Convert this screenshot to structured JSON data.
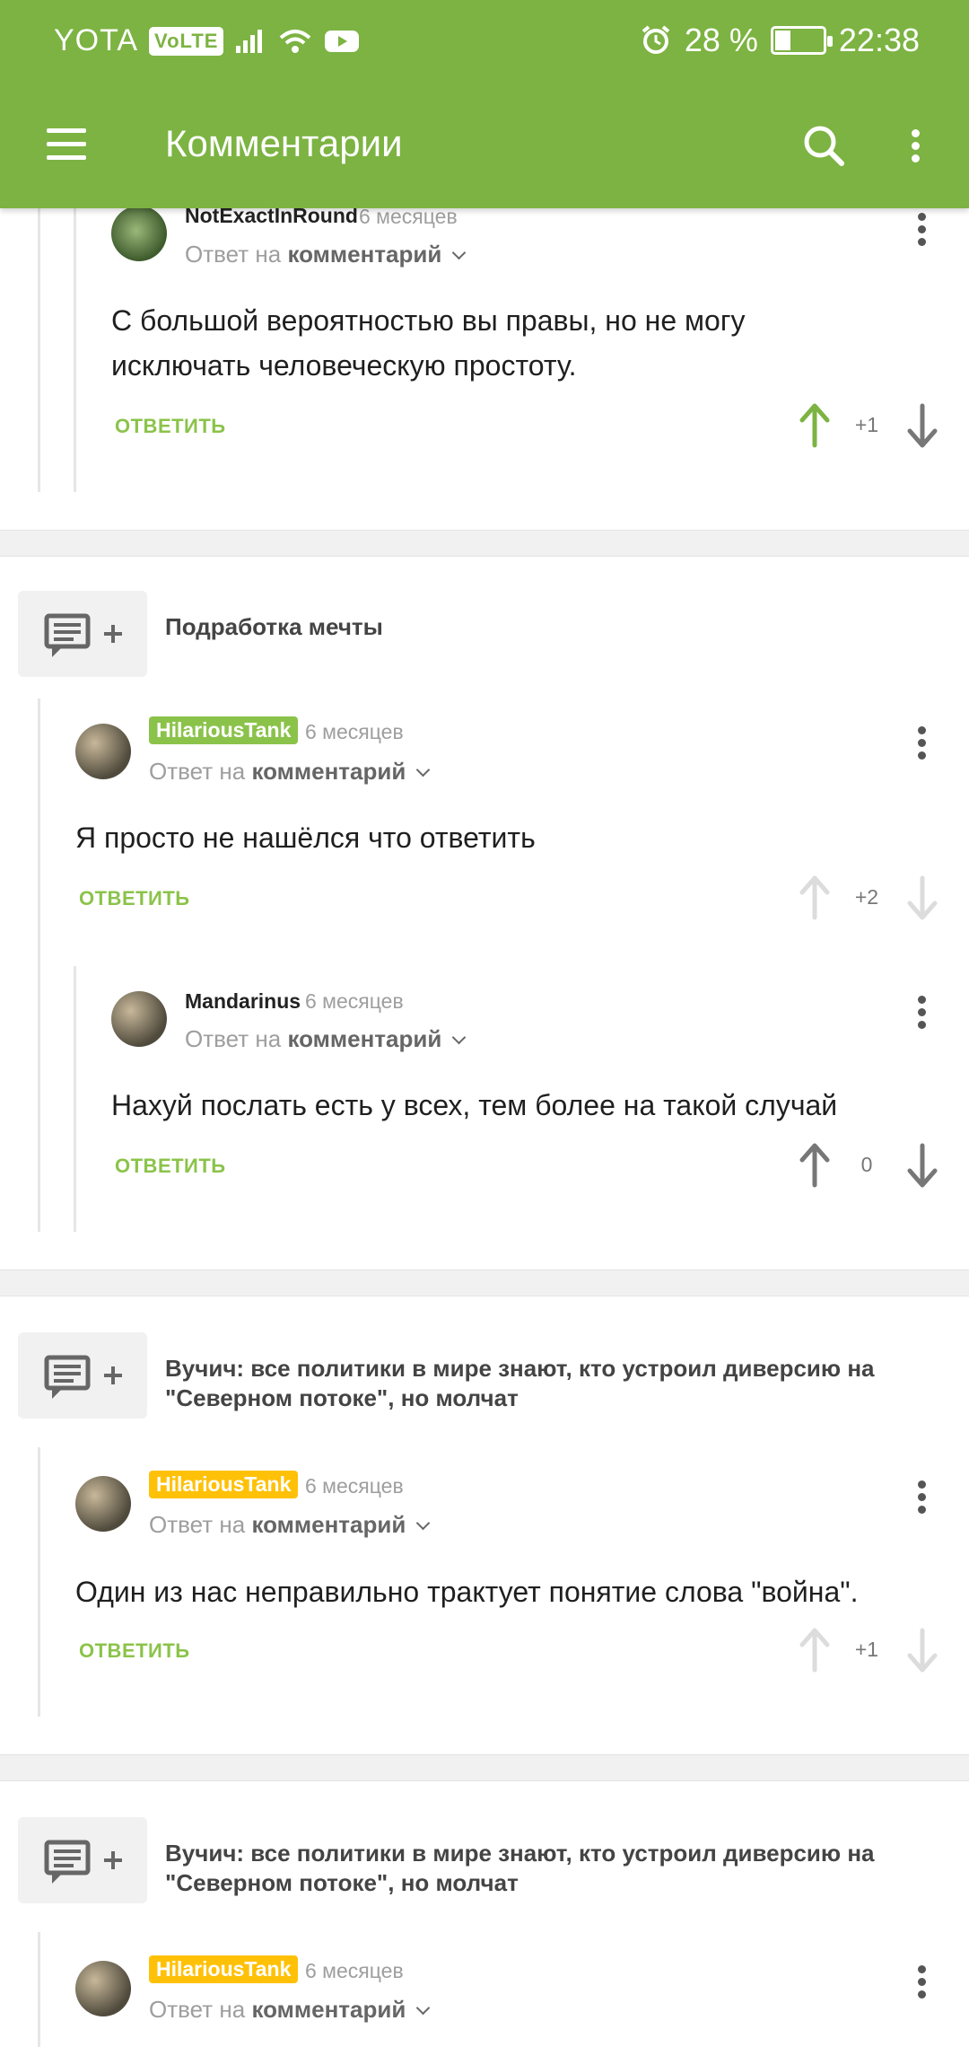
{
  "status_bar": {
    "carrier": "YOTA",
    "volte": "VoLTE",
    "battery": "28 %",
    "time": "22:38"
  },
  "app_bar": {
    "title": "Комментарии",
    "menu_icon": "hamburger-menu-icon",
    "search_icon": "search-icon",
    "more_icon": "more-vertical-icon"
  },
  "colors": {
    "accent": "#7cb342",
    "reply": "#8bc34a",
    "badge_green": "#8bc34a",
    "badge_yellow": "#ffc107"
  },
  "comments": [
    {
      "author": "NotExactInRound",
      "time": "6 месяцев",
      "reply_prefix": "Ответ на",
      "reply_link": "комментарий",
      "text": "С большой вероятностью вы правы, но не могу исключать человеческую простоту.",
      "reply_label": "ОТВЕТИТЬ",
      "score": "+1",
      "upvoted": true
    },
    {
      "post_title": "Подработка мечты",
      "author": "HilariousTank",
      "time": "6 месяцев",
      "reply_prefix": "Ответ на",
      "reply_link": "комментарий",
      "text": "Я просто не нашёлся что ответить",
      "reply_label": "ОТВЕТИТЬ",
      "score": "+2"
    },
    {
      "author": "Mandarinus",
      "time": "6 месяцев",
      "reply_prefix": "Ответ на",
      "reply_link": "комментарий",
      "text": "Нахуй послать есть у всех, тем более на такой случай",
      "reply_label": "ОТВЕТИТЬ",
      "score": "0"
    },
    {
      "post_title": "Вучич: все политики в мире знают, кто устроил диверсию на \"Северном потоке\", но молчат",
      "author": "HilariousTank",
      "time": "6 месяцев",
      "reply_prefix": "Ответ на",
      "reply_link": "комментарий",
      "text": "Один из нас неправильно трактует понятие слова \"война\".",
      "reply_label": "ОТВЕТИТЬ",
      "score": "+1"
    },
    {
      "post_title": "Вучич: все политики в мире знают, кто устроил диверсию на \"Северном потоке\", но молчат",
      "author": "HilariousTank",
      "time": "6 месяцев",
      "reply_prefix": "Ответ на",
      "reply_link": "комментарий"
    }
  ]
}
